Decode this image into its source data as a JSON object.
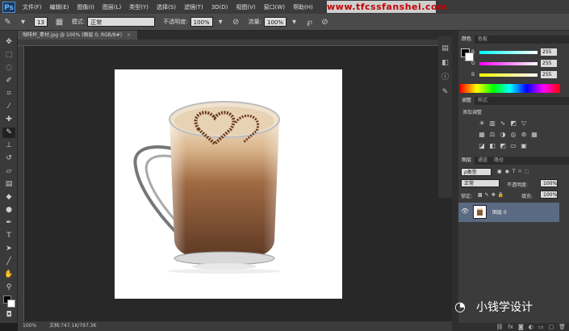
{
  "app": {
    "logo": "Ps"
  },
  "menubar": {
    "items": [
      "文件(F)",
      "编辑(E)",
      "图像(I)",
      "图层(L)",
      "类型(Y)",
      "选择(S)",
      "滤镜(T)",
      "3D(D)",
      "视图(V)",
      "窗口(W)",
      "帮助(H)"
    ]
  },
  "watermark_top": "www.tfcssfanshei.com",
  "options": {
    "brush_size": "13",
    "mode_label": "模式:",
    "mode_value": "正常",
    "opacity_label": "不透明度:",
    "opacity_value": "100%",
    "flow_label": "流量:",
    "flow_value": "100%"
  },
  "document": {
    "tab_title": "咖啡杯_素材.jpg @ 100% (图层 0, RGB/8#)",
    "close": "×"
  },
  "statusbar": {
    "zoom": "100%",
    "doc_info": "文档:747.1K/797.3K"
  },
  "color_panel": {
    "tabs": [
      "颜色",
      "色板"
    ],
    "r_label": "R",
    "r_value": "255",
    "g_label": "G",
    "g_value": "255",
    "b_label": "B",
    "b_value": "255",
    "foreground": "#000000",
    "background": "#ffffff"
  },
  "adjust_panel": {
    "tabs": [
      "调整",
      "样式"
    ],
    "title": "添加调整"
  },
  "layers_panel": {
    "tabs": [
      "图层",
      "通道",
      "路径"
    ],
    "filter_label": "ρ类型",
    "blend_mode": "正常",
    "opacity_label": "不透明度:",
    "opacity_value": "100%",
    "lock_label": "锁定:",
    "fill_label": "填充:",
    "fill_value": "100%",
    "layer_name": "图层 0"
  },
  "wechat_watermark": "小钱学设计"
}
